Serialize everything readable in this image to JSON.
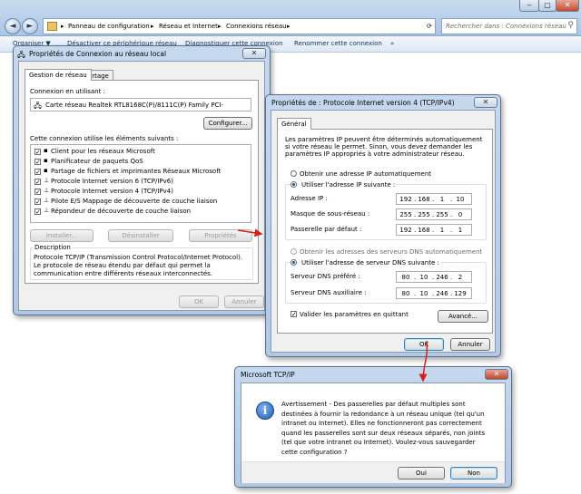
{
  "explorer": {
    "breadcrumb": [
      "Panneau de configuration",
      "Réseau et Internet",
      "Connexions réseau"
    ],
    "search_placeholder": "Rechercher dans : Connexions réseau",
    "commands": [
      "Organiser ▼",
      "Désactiver ce périphérique réseau",
      "Diagnostiquer cette connexion",
      "Renommer cette connexion",
      "»"
    ]
  },
  "lan_dialog": {
    "title": "Propriétés de Connexion au réseau local",
    "tabs": [
      "Gestion de réseau",
      "Partage"
    ],
    "connect_using_label": "Connexion en utilisant :",
    "adapter": "Carte réseau Realtek RTL8168C(P)/8111C(P) Family PCI-",
    "configure_button": "Configurer...",
    "items_label": "Cette connexion utilise les éléments suivants :",
    "items": [
      "Client pour les réseaux Microsoft",
      "Planificateur de paquets QoS",
      "Partage de fichiers et imprimantes Réseaux Microsoft",
      "Protocole Internet version 6 (TCP/IPv6)",
      "Protocole Internet version 4 (TCP/IPv4)",
      "Pilote E/S Mappage de découverte de couche liaison",
      "Répondeur de découverte de couche liaison"
    ],
    "install_button": "Installer...",
    "uninstall_button": "Désinstaller",
    "properties_button": "Propriétés",
    "description_label": "Description",
    "description": "Protocole TCP/IP (Transmission Control Protocol/Internet Protocol). Le protocole de réseau étendu par défaut qui permet la communication entre différents réseaux interconnectés.",
    "ok_button": "OK",
    "cancel_button": "Annuler"
  },
  "ipv4_dialog": {
    "title": "Propriétés de : Protocole Internet version 4 (TCP/IPv4)",
    "tab": "Général",
    "intro": "Les paramètres IP peuvent être déterminés automatiquement si votre réseau le permet. Sinon, vous devez demander les paramètres IP appropriés à votre administrateur réseau.",
    "auto_ip": "Obtenir une adresse IP automatiquement",
    "manual_ip": "Utiliser l'adresse IP suivante :",
    "ip_label": "Adresse IP :",
    "ip": [
      "192",
      "168",
      "1",
      "10"
    ],
    "mask_label": "Masque de sous-réseau :",
    "mask": [
      "255",
      "255",
      "255",
      "0"
    ],
    "gateway_label": "Passerelle par défaut :",
    "gateway": [
      "192",
      "168",
      "1",
      "1"
    ],
    "auto_dns": "Obtenir les adresses des serveurs DNS automatiquement",
    "manual_dns": "Utiliser l'adresse de serveur DNS suivante :",
    "dns1_label": "Serveur DNS préféré :",
    "dns1": [
      "80",
      "10",
      "246",
      "2"
    ],
    "dns2_label": "Serveur DNS auxiliaire :",
    "dns2": [
      "80",
      "10",
      "246",
      "129"
    ],
    "validate_label": "Valider les paramètres en quittant",
    "advanced_button": "Avancé...",
    "ok_button": "OK",
    "cancel_button": "Annuler"
  },
  "alert_dialog": {
    "title": "Microsoft TCP/IP",
    "message": "Avertissement - Des passerelles par défaut multiples sont destinées à fournir la redondance à un réseau unique (tel qu'un intranet ou Internet). Elles ne fonctionneront pas correctement quand les passerelles sont sur deux réseaux séparés, non joints (tel que votre intranet ou Internet). Voulez-vous sauvegarder cette configuration ?",
    "yes_button": "Oui",
    "no_button": "Non"
  },
  "colors": {
    "arrow": "#d6201a",
    "dialog_frame": "#b2c9e6",
    "info_icon": "#1f5fb5"
  }
}
